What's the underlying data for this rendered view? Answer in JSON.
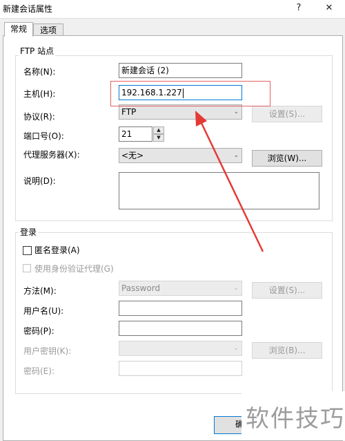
{
  "window": {
    "title": "新建会话属性",
    "help_glyph": "?",
    "close_glyph": "✕"
  },
  "tabs": [
    {
      "label": "常规",
      "active": true
    },
    {
      "label": "选项",
      "active": false
    }
  ],
  "ftp_site": {
    "group_label": "FTP 站点",
    "name_label": "名称(N):",
    "name_value": "新建会话 (2)",
    "host_label": "主机(H):",
    "host_value": "192.168.1.227",
    "protocol_label": "协议(R):",
    "protocol_value": "FTP",
    "protocol_settings_button": "设置(S)...",
    "port_label": "端口号(O):",
    "port_value": "21",
    "proxy_label": "代理服务器(X):",
    "proxy_value": "<无>",
    "browse_button": "浏览(W)...",
    "description_label": "说明(D):",
    "description_value": ""
  },
  "login": {
    "group_label": "登录",
    "anonymous_label": "匿名登录(A)",
    "identity_agent_label": "使用身份验证代理(G)",
    "method_label": "方法(M):",
    "method_value": "Password",
    "method_settings_button": "设置(S)...",
    "username_label": "用户名(U):",
    "username_value": "",
    "password_label": "密码(P):",
    "password_value": "",
    "user_key_label": "用户密钥(K):",
    "user_key_value": "",
    "browse_button": "浏览(B)...",
    "passphrase_label": "密码(E):",
    "passphrase_value": ""
  },
  "footer": {
    "connect_button_partial": "确"
  },
  "annotation": {
    "color": "#e53935"
  },
  "watermark": "软件技巧"
}
